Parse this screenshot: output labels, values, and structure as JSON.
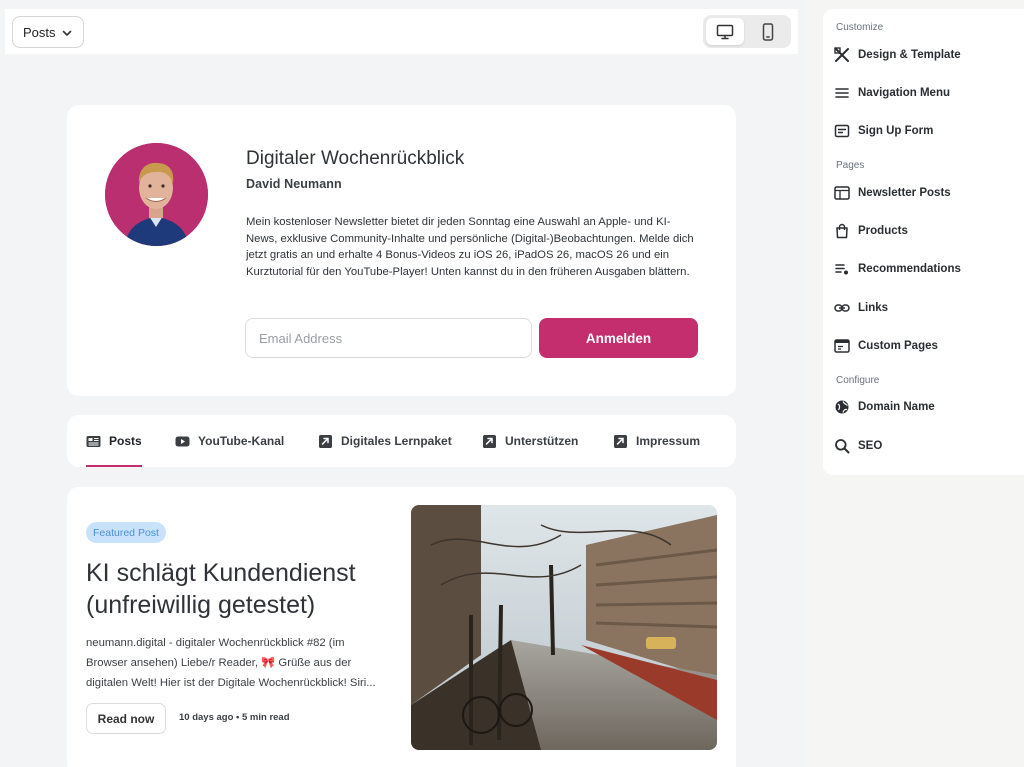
{
  "topbar": {
    "view_select": "Posts",
    "devices": [
      "desktop-icon",
      "mobile-icon"
    ]
  },
  "publication": {
    "title": "Digitaler Wochenrückblick",
    "author": "David Neumann",
    "description": "Mein kostenloser Newsletter bietet dir jeden Sonntag eine Auswahl an Apple- und KI-News, exklusive Community-Inhalte und persönliche (Digital-)Beobachtungen. Melde dich jetzt gratis an und erhalte 4 Bonus-Videos zu iOS 26, iPadOS 26, macOS 26 und ein Kurztutorial für den YouTube-Player! Unten kannst du in den früheren Ausgaben blättern.",
    "email_placeholder": "Email Address",
    "subscribe_label": "Anmelden"
  },
  "tabs": [
    {
      "label": "Posts",
      "icon": "newspaper-icon",
      "active": true
    },
    {
      "label": "YouTube-Kanal",
      "icon": "youtube-icon"
    },
    {
      "label": "Digitales Lernpaket",
      "icon": "external-link-icon"
    },
    {
      "label": "Unterstützen",
      "icon": "external-link-icon"
    },
    {
      "label": "Impressum",
      "icon": "external-link-icon"
    }
  ],
  "featured_post": {
    "badge": "Featured Post",
    "title": "KI schlägt Kundendienst (unfreiwillig getestet)",
    "excerpt": "neumann.digital - digitaler Wochenrückblick #82 (im Browser ansehen) Liebe/r Reader, 🎀 Grüße aus der digitalen Welt! Hier ist der Digitale Wochenrückblick! Siri...",
    "read_label": "Read now",
    "meta": "10 days ago • 5 min read"
  },
  "panel": {
    "customize_label": "Customize",
    "customize_items": [
      {
        "label": "Design & Template",
        "icon": "design-tools-icon"
      },
      {
        "label": "Navigation Menu",
        "icon": "menu-icon"
      },
      {
        "label": "Sign Up Form",
        "icon": "form-icon"
      }
    ],
    "pages_label": "Pages",
    "pages_items": [
      {
        "label": "Newsletter Posts",
        "icon": "newspaper-icon"
      },
      {
        "label": "Products",
        "icon": "shopping-bag-icon"
      },
      {
        "label": "Recommendations",
        "icon": "list-star-icon"
      },
      {
        "label": "Links",
        "icon": "link-icon"
      },
      {
        "label": "Custom Pages",
        "icon": "pages-icon"
      }
    ],
    "configure_label": "Configure",
    "configure_items": [
      {
        "label": "Domain Name",
        "icon": "globe-icon"
      },
      {
        "label": "SEO",
        "icon": "search-icon"
      }
    ]
  },
  "colors": {
    "accent": "#c42d6e",
    "badge_bg": "#c9e2fb",
    "badge_text": "#4a90d8",
    "canvas_bg": "#f3f4f6"
  }
}
